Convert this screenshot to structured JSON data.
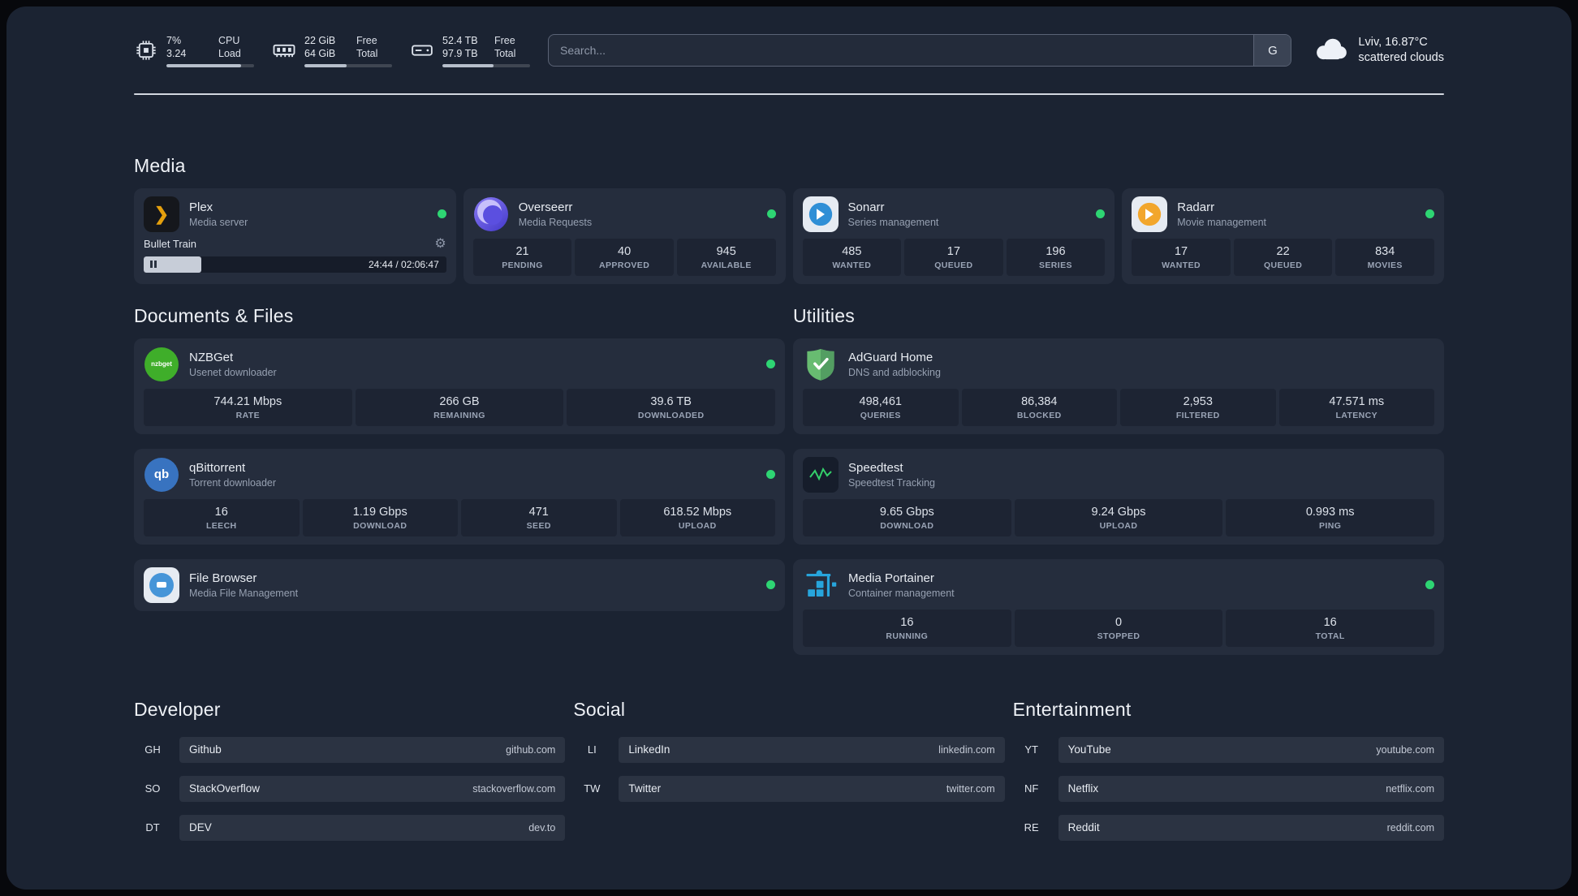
{
  "colors": {
    "status_green": "#2ed573",
    "plex_gold": "#e5a00d",
    "panel_bg": "#1b2332"
  },
  "topbar": {
    "resources": [
      {
        "id": "cpu",
        "values": [
          "7%",
          "3.24"
        ],
        "labels": [
          "CPU",
          "Load"
        ],
        "bar_percent": 85
      },
      {
        "id": "ram",
        "values": [
          "22 GiB",
          "64 GiB"
        ],
        "labels": [
          "Free",
          "Total"
        ],
        "bar_percent": 48
      },
      {
        "id": "disk",
        "values": [
          "52.4 TB",
          "97.9 TB"
        ],
        "labels": [
          "Free",
          "Total"
        ],
        "bar_percent": 58
      }
    ],
    "search": {
      "placeholder": "Search...",
      "provider_label": "G"
    },
    "weather": {
      "location": "Lviv, 16.87°C",
      "condition": "scattered clouds"
    }
  },
  "media": {
    "title": "Media",
    "plex": {
      "name": "Plex",
      "subtitle": "Media server",
      "now_playing": "Bullet Train",
      "gear_icon": "⚙",
      "time": "24:44 / 02:06:47",
      "progress_percent": 19
    },
    "services": [
      {
        "name": "Overseerr",
        "subtitle": "Media Requests",
        "stats": [
          {
            "value": "21",
            "label": "PENDING"
          },
          {
            "value": "40",
            "label": "APPROVED"
          },
          {
            "value": "945",
            "label": "AVAILABLE"
          }
        ]
      },
      {
        "name": "Sonarr",
        "subtitle": "Series management",
        "stats": [
          {
            "value": "485",
            "label": "WANTED"
          },
          {
            "value": "17",
            "label": "QUEUED"
          },
          {
            "value": "196",
            "label": "SERIES"
          }
        ]
      },
      {
        "name": "Radarr",
        "subtitle": "Movie management",
        "stats": [
          {
            "value": "17",
            "label": "WANTED"
          },
          {
            "value": "22",
            "label": "QUEUED"
          },
          {
            "value": "834",
            "label": "MOVIES"
          }
        ]
      }
    ]
  },
  "documents": {
    "title": "Documents & Files",
    "services": [
      {
        "name": "NZBGet",
        "subtitle": "Usenet downloader",
        "logo_text": "nzbget",
        "stats": [
          {
            "value": "744.21 Mbps",
            "label": "RATE"
          },
          {
            "value": "266 GB",
            "label": "REMAINING"
          },
          {
            "value": "39.6 TB",
            "label": "DOWNLOADED"
          }
        ]
      },
      {
        "name": "qBittorrent",
        "subtitle": "Torrent downloader",
        "logo_text": "qb",
        "stats": [
          {
            "value": "16",
            "label": "LEECH"
          },
          {
            "value": "1.19 Gbps",
            "label": "DOWNLOAD"
          },
          {
            "value": "471",
            "label": "SEED"
          },
          {
            "value": "618.52 Mbps",
            "label": "UPLOAD"
          }
        ]
      },
      {
        "name": "File Browser",
        "subtitle": "Media File Management",
        "stats": []
      }
    ]
  },
  "utilities": {
    "title": "Utilities",
    "services": [
      {
        "name": "AdGuard Home",
        "subtitle": "DNS and adblocking",
        "stats": [
          {
            "value": "498,461",
            "label": "QUERIES"
          },
          {
            "value": "86,384",
            "label": "BLOCKED"
          },
          {
            "value": "2,953",
            "label": "FILTERED"
          },
          {
            "value": "47.571 ms",
            "label": "LATENCY"
          }
        ]
      },
      {
        "name": "Speedtest",
        "subtitle": "Speedtest Tracking",
        "stats": [
          {
            "value": "9.65 Gbps",
            "label": "DOWNLOAD"
          },
          {
            "value": "9.24 Gbps",
            "label": "UPLOAD"
          },
          {
            "value": "0.993 ms",
            "label": "PING"
          }
        ]
      },
      {
        "name": "Media Portainer",
        "subtitle": "Container management",
        "stats": [
          {
            "value": "16",
            "label": "RUNNING"
          },
          {
            "value": "0",
            "label": "STOPPED"
          },
          {
            "value": "16",
            "label": "TOTAL"
          }
        ]
      }
    ]
  },
  "bookmarks": [
    {
      "title": "Developer",
      "items": [
        {
          "abbr": "GH",
          "name": "Github",
          "url": "github.com"
        },
        {
          "abbr": "SO",
          "name": "StackOverflow",
          "url": "stackoverflow.com"
        },
        {
          "abbr": "DT",
          "name": "DEV",
          "url": "dev.to"
        }
      ]
    },
    {
      "title": "Social",
      "items": [
        {
          "abbr": "LI",
          "name": "LinkedIn",
          "url": "linkedin.com"
        },
        {
          "abbr": "TW",
          "name": "Twitter",
          "url": "twitter.com"
        }
      ]
    },
    {
      "title": "Entertainment",
      "items": [
        {
          "abbr": "YT",
          "name": "YouTube",
          "url": "youtube.com"
        },
        {
          "abbr": "NF",
          "name": "Netflix",
          "url": "netflix.com"
        },
        {
          "abbr": "RE",
          "name": "Reddit",
          "url": "reddit.com"
        }
      ]
    }
  ]
}
